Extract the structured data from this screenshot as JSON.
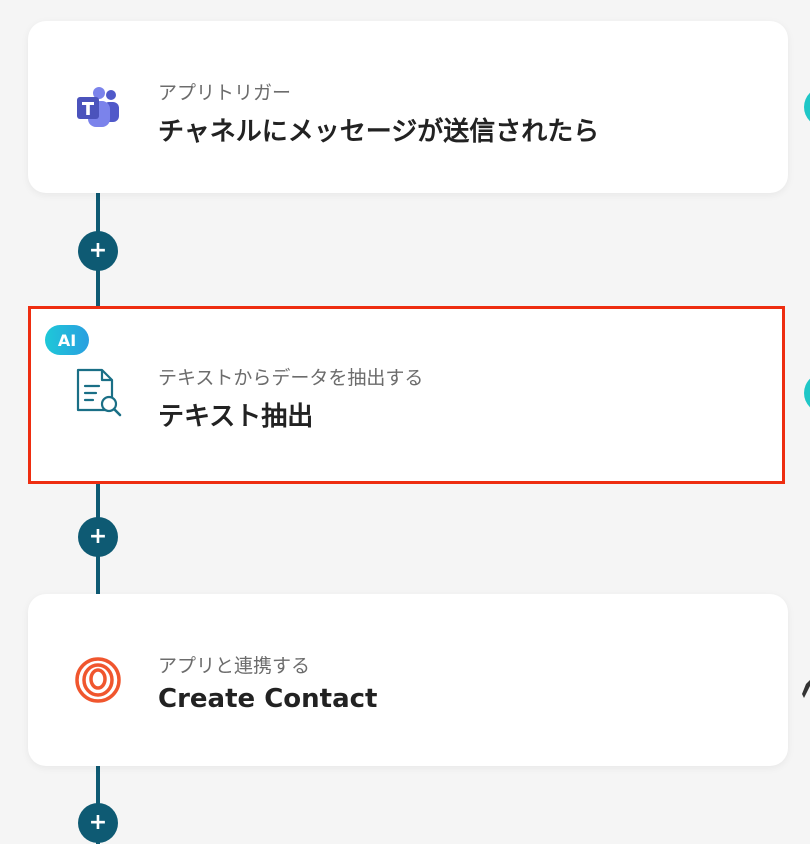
{
  "steps": [
    {
      "subtitle": "アプリトリガー",
      "title": "チャネルにメッセージが送信されたら",
      "icon": "microsoft-teams-icon"
    },
    {
      "badge": "AI",
      "subtitle": "テキストからデータを抽出する",
      "title": "テキスト抽出",
      "icon": "text-extraction-icon",
      "selected": true
    },
    {
      "subtitle": "アプリと連携する",
      "title": "Create Contact",
      "icon": "loop-rings-icon"
    }
  ],
  "add_button_symbol": "+",
  "colors": {
    "connector": "#0e5a73",
    "selection_border": "#ee2d10",
    "ai_badge": "#1ec8d8",
    "teams": "#5059c9",
    "extraction_icon": "#1a6f86",
    "app_icon": "#f0562e"
  }
}
